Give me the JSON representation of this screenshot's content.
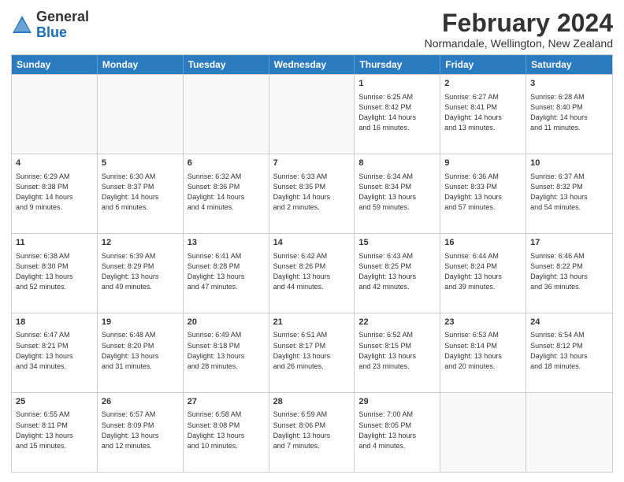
{
  "header": {
    "logo_general": "General",
    "logo_blue": "Blue",
    "main_title": "February 2024",
    "subtitle": "Normandale, Wellington, New Zealand"
  },
  "calendar": {
    "days": [
      "Sunday",
      "Monday",
      "Tuesday",
      "Wednesday",
      "Thursday",
      "Friday",
      "Saturday"
    ],
    "weeks": [
      [
        {
          "day": "",
          "empty": true
        },
        {
          "day": "",
          "empty": true
        },
        {
          "day": "",
          "empty": true
        },
        {
          "day": "",
          "empty": true
        },
        {
          "day": "1",
          "lines": [
            "Sunrise: 6:25 AM",
            "Sunset: 8:42 PM",
            "Daylight: 14 hours",
            "and 16 minutes."
          ]
        },
        {
          "day": "2",
          "lines": [
            "Sunrise: 6:27 AM",
            "Sunset: 8:41 PM",
            "Daylight: 14 hours",
            "and 13 minutes."
          ]
        },
        {
          "day": "3",
          "lines": [
            "Sunrise: 6:28 AM",
            "Sunset: 8:40 PM",
            "Daylight: 14 hours",
            "and 11 minutes."
          ]
        }
      ],
      [
        {
          "day": "4",
          "lines": [
            "Sunrise: 6:29 AM",
            "Sunset: 8:38 PM",
            "Daylight: 14 hours",
            "and 9 minutes."
          ]
        },
        {
          "day": "5",
          "lines": [
            "Sunrise: 6:30 AM",
            "Sunset: 8:37 PM",
            "Daylight: 14 hours",
            "and 6 minutes."
          ]
        },
        {
          "day": "6",
          "lines": [
            "Sunrise: 6:32 AM",
            "Sunset: 8:36 PM",
            "Daylight: 14 hours",
            "and 4 minutes."
          ]
        },
        {
          "day": "7",
          "lines": [
            "Sunrise: 6:33 AM",
            "Sunset: 8:35 PM",
            "Daylight: 14 hours",
            "and 2 minutes."
          ]
        },
        {
          "day": "8",
          "lines": [
            "Sunrise: 6:34 AM",
            "Sunset: 8:34 PM",
            "Daylight: 13 hours",
            "and 59 minutes."
          ]
        },
        {
          "day": "9",
          "lines": [
            "Sunrise: 6:36 AM",
            "Sunset: 8:33 PM",
            "Daylight: 13 hours",
            "and 57 minutes."
          ]
        },
        {
          "day": "10",
          "lines": [
            "Sunrise: 6:37 AM",
            "Sunset: 8:32 PM",
            "Daylight: 13 hours",
            "and 54 minutes."
          ]
        }
      ],
      [
        {
          "day": "11",
          "lines": [
            "Sunrise: 6:38 AM",
            "Sunset: 8:30 PM",
            "Daylight: 13 hours",
            "and 52 minutes."
          ]
        },
        {
          "day": "12",
          "lines": [
            "Sunrise: 6:39 AM",
            "Sunset: 8:29 PM",
            "Daylight: 13 hours",
            "and 49 minutes."
          ]
        },
        {
          "day": "13",
          "lines": [
            "Sunrise: 6:41 AM",
            "Sunset: 8:28 PM",
            "Daylight: 13 hours",
            "and 47 minutes."
          ]
        },
        {
          "day": "14",
          "lines": [
            "Sunrise: 6:42 AM",
            "Sunset: 8:26 PM",
            "Daylight: 13 hours",
            "and 44 minutes."
          ]
        },
        {
          "day": "15",
          "lines": [
            "Sunrise: 6:43 AM",
            "Sunset: 8:25 PM",
            "Daylight: 13 hours",
            "and 42 minutes."
          ]
        },
        {
          "day": "16",
          "lines": [
            "Sunrise: 6:44 AM",
            "Sunset: 8:24 PM",
            "Daylight: 13 hours",
            "and 39 minutes."
          ]
        },
        {
          "day": "17",
          "lines": [
            "Sunrise: 6:46 AM",
            "Sunset: 8:22 PM",
            "Daylight: 13 hours",
            "and 36 minutes."
          ]
        }
      ],
      [
        {
          "day": "18",
          "lines": [
            "Sunrise: 6:47 AM",
            "Sunset: 8:21 PM",
            "Daylight: 13 hours",
            "and 34 minutes."
          ]
        },
        {
          "day": "19",
          "lines": [
            "Sunrise: 6:48 AM",
            "Sunset: 8:20 PM",
            "Daylight: 13 hours",
            "and 31 minutes."
          ]
        },
        {
          "day": "20",
          "lines": [
            "Sunrise: 6:49 AM",
            "Sunset: 8:18 PM",
            "Daylight: 13 hours",
            "and 28 minutes."
          ]
        },
        {
          "day": "21",
          "lines": [
            "Sunrise: 6:51 AM",
            "Sunset: 8:17 PM",
            "Daylight: 13 hours",
            "and 26 minutes."
          ]
        },
        {
          "day": "22",
          "lines": [
            "Sunrise: 6:52 AM",
            "Sunset: 8:15 PM",
            "Daylight: 13 hours",
            "and 23 minutes."
          ]
        },
        {
          "day": "23",
          "lines": [
            "Sunrise: 6:53 AM",
            "Sunset: 8:14 PM",
            "Daylight: 13 hours",
            "and 20 minutes."
          ]
        },
        {
          "day": "24",
          "lines": [
            "Sunrise: 6:54 AM",
            "Sunset: 8:12 PM",
            "Daylight: 13 hours",
            "and 18 minutes."
          ]
        }
      ],
      [
        {
          "day": "25",
          "lines": [
            "Sunrise: 6:55 AM",
            "Sunset: 8:11 PM",
            "Daylight: 13 hours",
            "and 15 minutes."
          ]
        },
        {
          "day": "26",
          "lines": [
            "Sunrise: 6:57 AM",
            "Sunset: 8:09 PM",
            "Daylight: 13 hours",
            "and 12 minutes."
          ]
        },
        {
          "day": "27",
          "lines": [
            "Sunrise: 6:58 AM",
            "Sunset: 8:08 PM",
            "Daylight: 13 hours",
            "and 10 minutes."
          ]
        },
        {
          "day": "28",
          "lines": [
            "Sunrise: 6:59 AM",
            "Sunset: 8:06 PM",
            "Daylight: 13 hours",
            "and 7 minutes."
          ]
        },
        {
          "day": "29",
          "lines": [
            "Sunrise: 7:00 AM",
            "Sunset: 8:05 PM",
            "Daylight: 13 hours",
            "and 4 minutes."
          ]
        },
        {
          "day": "",
          "empty": true
        },
        {
          "day": "",
          "empty": true
        }
      ]
    ]
  }
}
